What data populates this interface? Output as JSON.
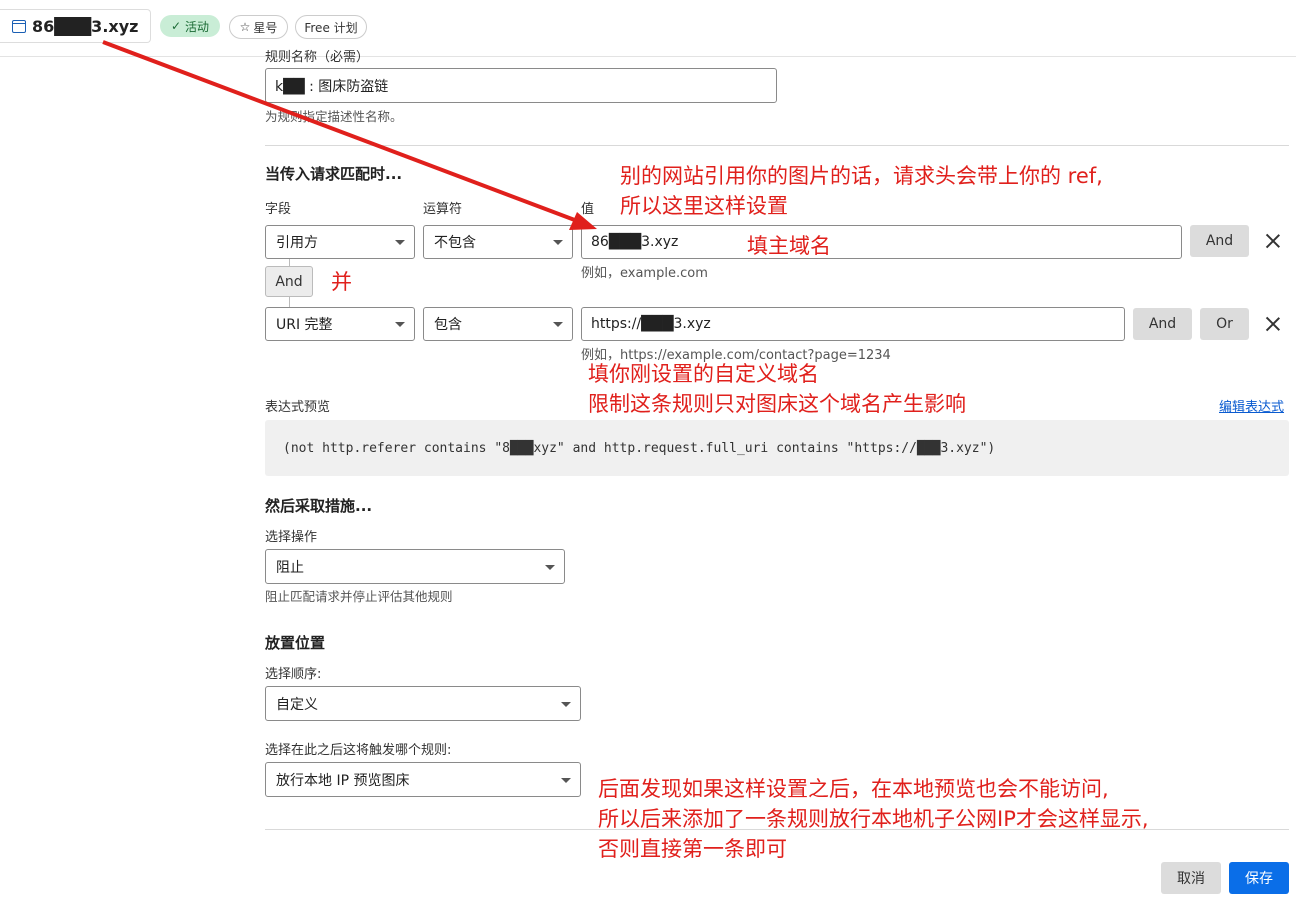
{
  "topbar": {
    "domain": "86███3.xyz",
    "status_badge": "活动",
    "star_label": "星号",
    "plan_label": "Free 计划"
  },
  "rule_name": {
    "label": "规则名称（必需）",
    "value": "k██ : 图床防盗链",
    "help": "为规则指定描述性名称。"
  },
  "match": {
    "heading": "当传入请求匹配时...",
    "col_field": "字段",
    "col_operator": "运算符",
    "col_value": "值",
    "row1": {
      "field": "引用方",
      "operator": "不包含",
      "value": "86███3.xyz",
      "example": "例如，example.com",
      "and_label": "And"
    },
    "connector": "And",
    "row2": {
      "field": "URI 完整",
      "operator": "包含",
      "value": "https://███3.xyz",
      "example": "例如，https://example.com/contact?page=1234",
      "and_label": "And",
      "or_label": "Or"
    }
  },
  "expression": {
    "label": "表达式预览",
    "edit_link": "编辑表达式",
    "text": "(not http.referer contains \"8███xyz\" and http.request.full_uri contains \"https://███3.xyz\")"
  },
  "action": {
    "heading": "然后采取措施...",
    "label": "选择操作",
    "value": "阻止",
    "help": "阻止匹配请求并停止评估其他规则"
  },
  "placement": {
    "heading": "放置位置",
    "order_label": "选择顺序:",
    "order_value": "自定义",
    "after_label": "选择在此之后这将触发哪个规则:",
    "after_value": "放行本地 IP 预览图床"
  },
  "footer": {
    "cancel": "取消",
    "save": "保存"
  },
  "annotations": {
    "ref_line1": "别的网站引用你的图片的话，请求头会带上你的 ref,",
    "ref_line2": "所以这里这样设置",
    "main_domain": "填主域名",
    "and_note": "并",
    "custom_line1": "填你刚设置的自定义域名",
    "custom_line2": "限制这条规则只对图床这个域名产生影响",
    "bottom_line1": "后面发现如果这样设置之后，在本地预览也会不能访问,",
    "bottom_line2": "所以后来添加了一条规则放行本地机子公网IP才会这样显示,",
    "bottom_line3": "否则直接第一条即可"
  },
  "colors": {
    "annotation": "#e0201c",
    "primary_button": "#0a6ee8",
    "active_badge_bg": "#c9edd6"
  }
}
